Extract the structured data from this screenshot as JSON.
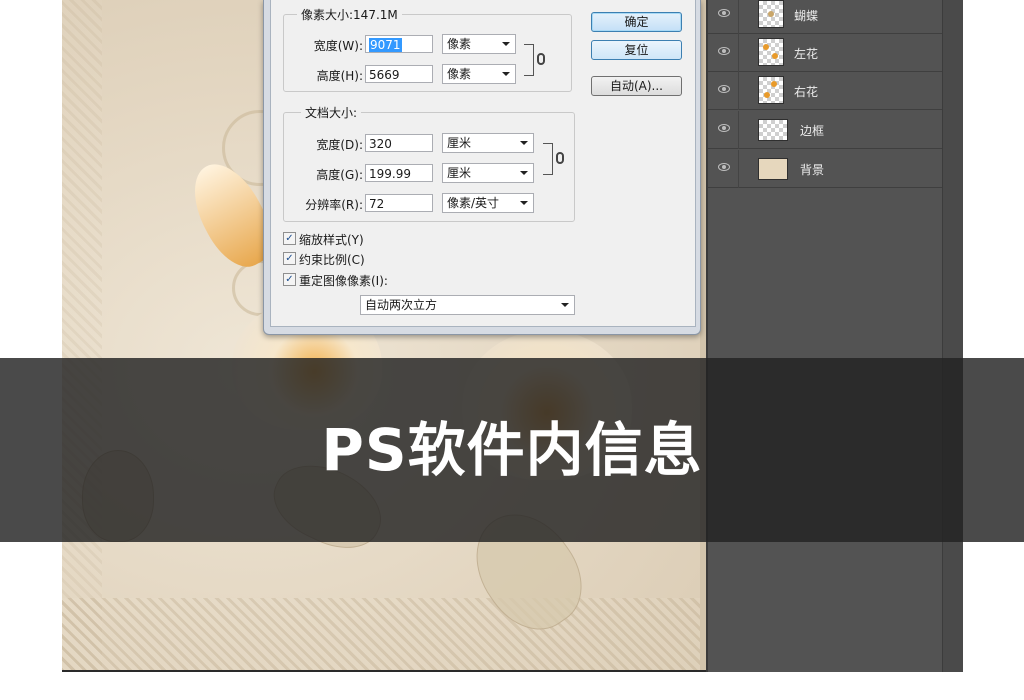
{
  "dialog": {
    "pixel_dimensions": {
      "title": "像素大小:147.1M",
      "width_label": "宽度(W):",
      "width_value": "9071",
      "width_unit": "像素",
      "height_label": "高度(H):",
      "height_value": "5669",
      "height_unit": "像素"
    },
    "document_size": {
      "title": "文档大小:",
      "width_label": "宽度(D):",
      "width_value": "320",
      "width_unit": "厘米",
      "height_label": "高度(G):",
      "height_value": "199.99",
      "height_unit": "厘米",
      "resolution_label": "分辨率(R):",
      "resolution_value": "72",
      "resolution_unit": "像素/英寸"
    },
    "options": [
      {
        "label": "缩放样式(Y)",
        "checked": true
      },
      {
        "label": "约束比例(C)",
        "checked": true
      },
      {
        "label": "重定图像像素(I):",
        "checked": true
      }
    ],
    "resample_method": "自动两次立方",
    "buttons": {
      "ok": "确定",
      "reset": "复位",
      "auto": "自动(A)..."
    }
  },
  "layers": [
    {
      "name": "蝴蝶",
      "thumbnail": "transparent-with-butterfly",
      "visible": true
    },
    {
      "name": "左花",
      "thumbnail": "transparent-with-flower",
      "visible": true
    },
    {
      "name": "右花",
      "thumbnail": "transparent-with-flower",
      "visible": true
    },
    {
      "name": "边框",
      "thumbnail": "transparent",
      "visible": true
    },
    {
      "name": "背景",
      "thumbnail": "beige-fill",
      "visible": true
    }
  ],
  "banner": {
    "text": "PS软件内信息"
  },
  "colors": {
    "banner_bg": "#222222",
    "panel_bg": "#535353",
    "canvas_bg": "#e3d6c1",
    "selection": "#3399ff"
  }
}
